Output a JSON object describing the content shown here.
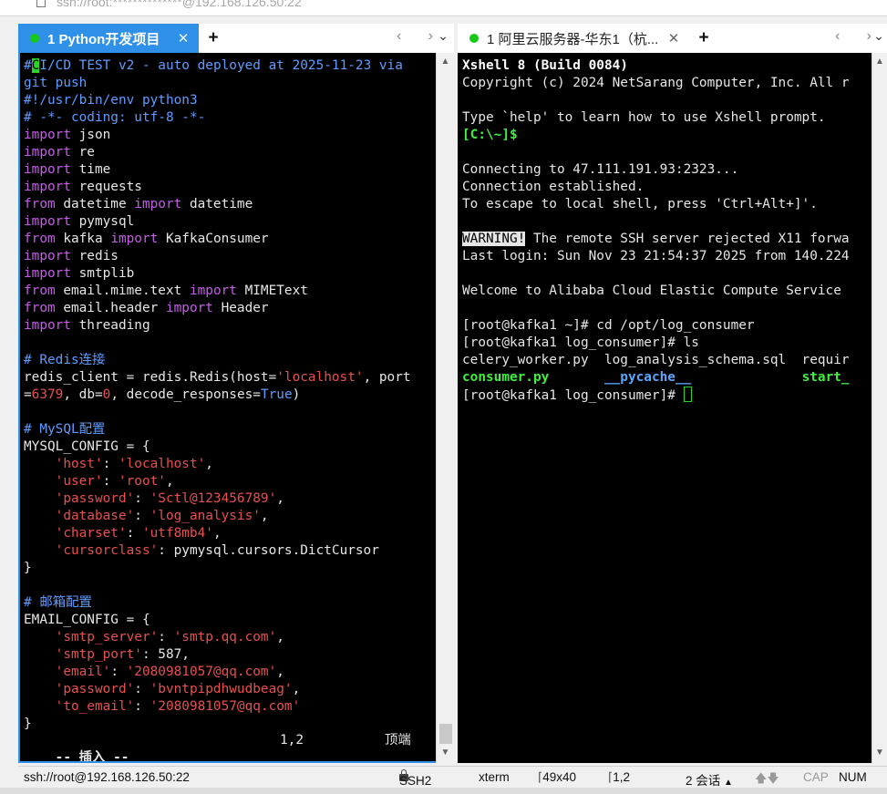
{
  "window": {
    "address_hint": "ssh://root:**************@192.168.126.50:22"
  },
  "tabs_left": {
    "active_tab": "1 Python开发项目",
    "close_glyph": "✕",
    "add_glyph": "+",
    "prev_glyph": "‹",
    "next_glyph": "›",
    "menu_glyph": "⌄"
  },
  "tabs_right": {
    "tab": "1 阿里云服务器-华东1（杭...",
    "close_glyph": "✕",
    "add_glyph": "+",
    "prev_glyph": "‹",
    "next_glyph": "›",
    "menu_glyph": "⌄"
  },
  "editor": {
    "lines": [
      [
        {
          "t": "#",
          "c": "com"
        },
        {
          "t": "C",
          "c": "cur"
        },
        {
          "t": "I/CD TEST v2 - auto deployed at 2025-11-23 via",
          "c": "com"
        }
      ],
      [
        {
          "t": "git push",
          "c": "com"
        }
      ],
      [
        {
          "t": "#!/usr/bin/env python3",
          "c": "com"
        }
      ],
      [
        {
          "t": "# -*- coding: utf-8 -*-",
          "c": "com"
        }
      ],
      [
        {
          "t": "import",
          "c": "kw"
        },
        {
          "t": " json",
          "c": ""
        }
      ],
      [
        {
          "t": "import",
          "c": "kw"
        },
        {
          "t": " re",
          "c": ""
        }
      ],
      [
        {
          "t": "import",
          "c": "kw"
        },
        {
          "t": " time",
          "c": ""
        }
      ],
      [
        {
          "t": "import",
          "c": "kw"
        },
        {
          "t": " requests",
          "c": ""
        }
      ],
      [
        {
          "t": "from",
          "c": "kw"
        },
        {
          "t": " datetime ",
          "c": ""
        },
        {
          "t": "import",
          "c": "kw"
        },
        {
          "t": " datetime",
          "c": ""
        }
      ],
      [
        {
          "t": "import",
          "c": "kw"
        },
        {
          "t": " pymysql",
          "c": ""
        }
      ],
      [
        {
          "t": "from",
          "c": "kw"
        },
        {
          "t": " kafka ",
          "c": ""
        },
        {
          "t": "import",
          "c": "kw"
        },
        {
          "t": " KafkaConsumer",
          "c": ""
        }
      ],
      [
        {
          "t": "import",
          "c": "kw"
        },
        {
          "t": " redis",
          "c": ""
        }
      ],
      [
        {
          "t": "import",
          "c": "kw"
        },
        {
          "t": " smtplib",
          "c": ""
        }
      ],
      [
        {
          "t": "from",
          "c": "kw"
        },
        {
          "t": " email.mime.text ",
          "c": ""
        },
        {
          "t": "import",
          "c": "kw"
        },
        {
          "t": " MIMEText",
          "c": ""
        }
      ],
      [
        {
          "t": "from",
          "c": "kw"
        },
        {
          "t": " email.header ",
          "c": ""
        },
        {
          "t": "import",
          "c": "kw"
        },
        {
          "t": " Header",
          "c": ""
        }
      ],
      [
        {
          "t": "import",
          "c": "kw"
        },
        {
          "t": " threading",
          "c": ""
        }
      ],
      [],
      [
        {
          "t": "# Redis连接",
          "c": "com"
        }
      ],
      [
        {
          "t": "redis_client = redis.Redis(host=",
          "c": ""
        },
        {
          "t": "'localhost'",
          "c": "str"
        },
        {
          "t": ", port",
          "c": ""
        }
      ],
      [
        {
          "t": "=",
          "c": ""
        },
        {
          "t": "6379",
          "c": "num"
        },
        {
          "t": ", db=",
          "c": ""
        },
        {
          "t": "0",
          "c": "num"
        },
        {
          "t": ", decode_responses=",
          "c": ""
        },
        {
          "t": "True",
          "c": "true"
        },
        {
          "t": ")",
          "c": ""
        }
      ],
      [],
      [
        {
          "t": "# MySQL配置",
          "c": "com"
        }
      ],
      [
        {
          "t": "MYSQL_CONFIG = {",
          "c": ""
        }
      ],
      [
        {
          "t": "    ",
          "c": ""
        },
        {
          "t": "'host'",
          "c": "str"
        },
        {
          "t": ": ",
          "c": ""
        },
        {
          "t": "'localhost'",
          "c": "str"
        },
        {
          "t": ",",
          "c": ""
        }
      ],
      [
        {
          "t": "    ",
          "c": ""
        },
        {
          "t": "'user'",
          "c": "str"
        },
        {
          "t": ": ",
          "c": ""
        },
        {
          "t": "'root'",
          "c": "str"
        },
        {
          "t": ",",
          "c": ""
        }
      ],
      [
        {
          "t": "    ",
          "c": ""
        },
        {
          "t": "'password'",
          "c": "str"
        },
        {
          "t": ": ",
          "c": ""
        },
        {
          "t": "'Sctl@123456789'",
          "c": "str"
        },
        {
          "t": ",",
          "c": ""
        }
      ],
      [
        {
          "t": "    ",
          "c": ""
        },
        {
          "t": "'database'",
          "c": "str"
        },
        {
          "t": ": ",
          "c": ""
        },
        {
          "t": "'log_analysis'",
          "c": "str"
        },
        {
          "t": ",",
          "c": ""
        }
      ],
      [
        {
          "t": "    ",
          "c": ""
        },
        {
          "t": "'charset'",
          "c": "str"
        },
        {
          "t": ": ",
          "c": ""
        },
        {
          "t": "'utf8mb4'",
          "c": "str"
        },
        {
          "t": ",",
          "c": ""
        }
      ],
      [
        {
          "t": "    ",
          "c": ""
        },
        {
          "t": "'cursorclass'",
          "c": "str"
        },
        {
          "t": ": pymysql.cursors.DictCursor",
          "c": ""
        }
      ],
      [
        {
          "t": "}",
          "c": ""
        }
      ],
      [],
      [
        {
          "t": "# 邮箱配置",
          "c": "com"
        }
      ],
      [
        {
          "t": "EMAIL_CONFIG = {",
          "c": ""
        }
      ],
      [
        {
          "t": "    ",
          "c": ""
        },
        {
          "t": "'smtp_server'",
          "c": "str"
        },
        {
          "t": ": ",
          "c": ""
        },
        {
          "t": "'smtp.qq.com'",
          "c": "str"
        },
        {
          "t": ",",
          "c": ""
        }
      ],
      [
        {
          "t": "    ",
          "c": ""
        },
        {
          "t": "'smtp_port'",
          "c": "str"
        },
        {
          "t": ": 587,",
          "c": ""
        }
      ],
      [
        {
          "t": "    ",
          "c": ""
        },
        {
          "t": "'email'",
          "c": "str"
        },
        {
          "t": ": ",
          "c": ""
        },
        {
          "t": "'2080981057@qq.com'",
          "c": "str"
        },
        {
          "t": ",",
          "c": ""
        }
      ],
      [
        {
          "t": "    ",
          "c": ""
        },
        {
          "t": "'password'",
          "c": "str"
        },
        {
          "t": ": ",
          "c": ""
        },
        {
          "t": "'bvntpipdhwudbeag'",
          "c": "str"
        },
        {
          "t": ",",
          "c": ""
        }
      ],
      [
        {
          "t": "    ",
          "c": ""
        },
        {
          "t": "'to_email'",
          "c": "str"
        },
        {
          "t": ": ",
          "c": ""
        },
        {
          "t": "'2080981057@qq.com'",
          "c": "str"
        }
      ],
      [
        {
          "t": "}",
          "c": ""
        }
      ]
    ],
    "mode_text": "-- 插入 --",
    "position": "1,2",
    "scroll_label": "顶端"
  },
  "terminal": {
    "lines": [
      [
        {
          "t": "Xshell 8 (Build 0084)",
          "c": "bold"
        }
      ],
      [
        {
          "t": "Copyright (c) 2024 NetSarang Computer, Inc. All r",
          "c": ""
        }
      ],
      [],
      [
        {
          "t": "Type `help' to learn how to use Xshell prompt.",
          "c": ""
        }
      ],
      [
        {
          "t": "[C:\\~]$",
          "c": "green"
        }
      ],
      [],
      [
        {
          "t": "Connecting to 47.111.191.93:2323...",
          "c": ""
        }
      ],
      [
        {
          "t": "Connection established.",
          "c": ""
        }
      ],
      [
        {
          "t": "To escape to local shell, press 'Ctrl+Alt+]'.",
          "c": ""
        }
      ],
      [],
      [
        {
          "t": "WARNING!",
          "c": "warn"
        },
        {
          "t": " The remote SSH server rejected X11 forwa",
          "c": ""
        }
      ],
      [
        {
          "t": "Last login: Sun Nov 23 21:54:37 2025 from 140.224",
          "c": ""
        }
      ],
      [],
      [
        {
          "t": "Welcome to Alibaba Cloud Elastic Compute Service",
          "c": ""
        }
      ],
      [],
      [
        {
          "t": "[root@kafka1 ~]# cd /opt/log_consumer",
          "c": ""
        }
      ],
      [
        {
          "t": "[root@kafka1 log_consumer]# ls",
          "c": ""
        }
      ],
      [
        {
          "t": "celery_worker.py  log_analysis_schema.sql  requir",
          "c": ""
        }
      ],
      [
        {
          "t": "consumer.py",
          "c": "green"
        },
        {
          "t": "       ",
          "c": ""
        },
        {
          "t": "__pycache__",
          "c": "blue"
        },
        {
          "t": "              ",
          "c": ""
        },
        {
          "t": "start_",
          "c": "green"
        }
      ],
      [
        {
          "t": "[root@kafka1 log_consumer]# ",
          "c": ""
        },
        {
          "t": "",
          "c": "cursorbox"
        }
      ]
    ]
  },
  "statusbar": {
    "session": "ssh://root@192.168.126.50:22",
    "protocol": "SSH2",
    "term": "xterm",
    "size": "49x40",
    "cursor_pos": "1,2",
    "sessions": "2 会话",
    "up_glyph": "▲",
    "arrows_glyph": "🡅🡇",
    "cap": "CAP",
    "num": "NUM"
  },
  "colors": {
    "accent": "#2f90e8",
    "terminal_bg": "#000000",
    "status_dot": "#17c817"
  }
}
